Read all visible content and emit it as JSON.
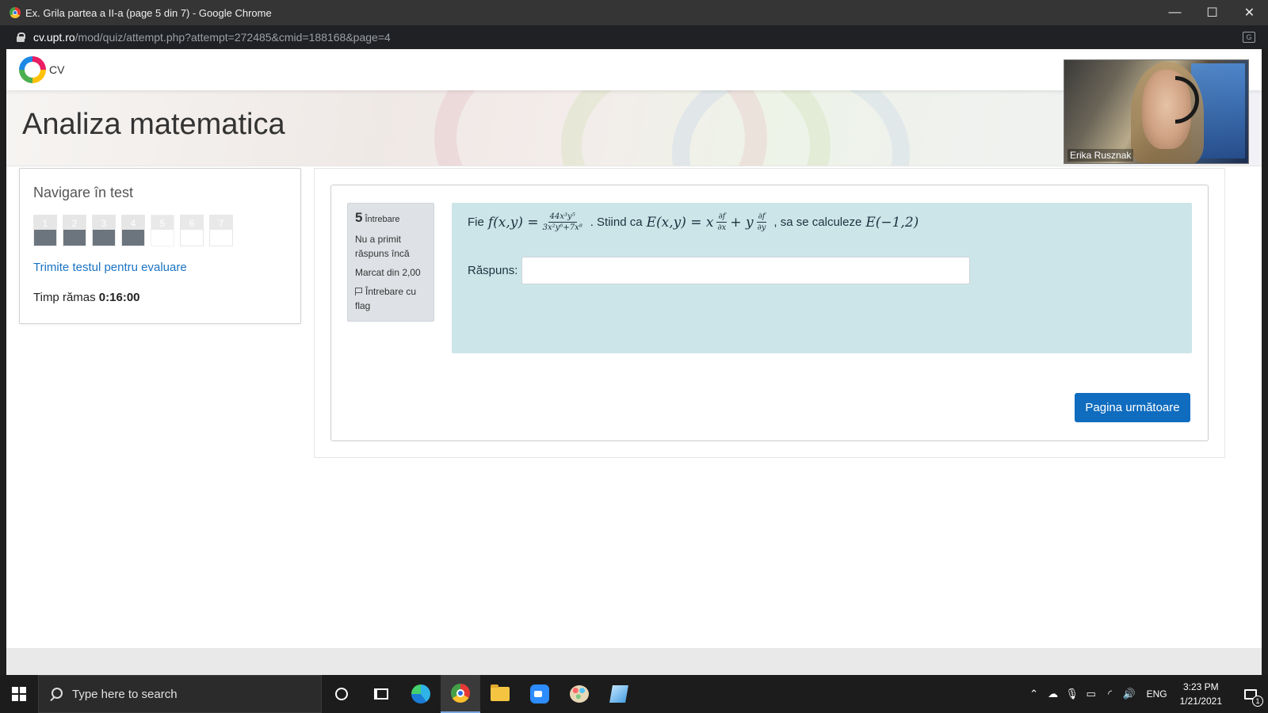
{
  "window": {
    "title": "Ex. Grila partea a II-a (page 5 din 7) - Google Chrome",
    "minimize": "—",
    "maximize": "☐",
    "close": "✕"
  },
  "address": {
    "host": "cv.upt.ro",
    "path": "/mod/quiz/attempt.php?attempt=272485&cmid=188168&page=4"
  },
  "site": {
    "logo_text": "CV",
    "course_title": "Analiza matematica"
  },
  "quiz_nav": {
    "title": "Navigare în test",
    "buttons": [
      {
        "label": "1",
        "answered": true
      },
      {
        "label": "2",
        "answered": true
      },
      {
        "label": "3",
        "answered": true
      },
      {
        "label": "4",
        "answered": true
      },
      {
        "label": "5",
        "answered": false
      },
      {
        "label": "6",
        "answered": false
      },
      {
        "label": "7",
        "answered": false
      }
    ],
    "submit_link": "Trimite testul pentru evaluare",
    "time_label": "Timp rămas",
    "time_value": "0:16:00"
  },
  "question": {
    "number": "5",
    "word": "Întrebare",
    "state": "Nu a primit răspuns încă",
    "grade": "Marcat din 2,00",
    "flag_label": "Întrebare cu flag",
    "text_fie": "Fie",
    "f_lhs": "f(x,y) =",
    "f_num": "44x³y⁵",
    "f_den": "3x²y⁶+7x⁸",
    "text_stiind": ". Stiind ca",
    "e_lhs": "E(x,y) = x",
    "df": "∂f",
    "dx": "∂x",
    "plus_y": "+ y",
    "dy": "∂y",
    "text_calc": ", sa se calculeze",
    "e_point": "E(−1,2)",
    "answer_label": "Răspuns:",
    "answer_value": ""
  },
  "next_button": "Pagina următoare",
  "video": {
    "participant": "Erika Rusznak"
  },
  "taskbar": {
    "search_placeholder": "Type here to search",
    "language": "ENG",
    "time": "3:23 PM",
    "date": "1/21/2021",
    "notification_count": "1"
  }
}
